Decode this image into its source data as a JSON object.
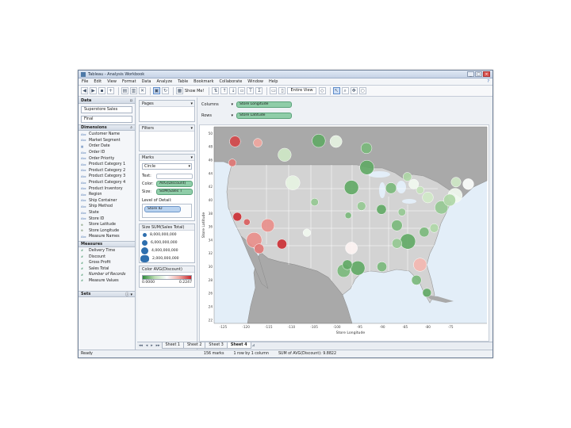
{
  "window": {
    "title": "Tableau - Analysis Workbook",
    "controls": [
      "_",
      "□",
      "×"
    ]
  },
  "menu": [
    "File",
    "Edit",
    "View",
    "Format",
    "Data",
    "Analyze",
    "Table",
    "Bookmark",
    "Collaborate",
    "Window",
    "Help"
  ],
  "toolbar": {
    "show_me_label": "Show Me!",
    "fit_select": "Entire View"
  },
  "data_panel": {
    "header": "Data",
    "datasources": [
      "Superstore Sales",
      "Final"
    ],
    "dimensions_header": "Dimensions",
    "dimensions": [
      {
        "type": "Abc",
        "name": "Customer Name"
      },
      {
        "type": "Abc",
        "name": "Market Segment"
      },
      {
        "type": "date",
        "name": "Order Date"
      },
      {
        "type": "Abc",
        "name": "Order ID"
      },
      {
        "type": "Abc",
        "name": "Order Priority"
      },
      {
        "type": "Abc",
        "name": "Product Category 1"
      },
      {
        "type": "Abc",
        "name": "Product Category 2"
      },
      {
        "type": "Abc",
        "name": "Product Category 3"
      },
      {
        "type": "Abc",
        "name": "Product Category 4"
      },
      {
        "type": "Abc",
        "name": "Product Inventory"
      },
      {
        "type": "Abc",
        "name": "Region"
      },
      {
        "type": "Abc",
        "name": "Ship Container"
      },
      {
        "type": "Abc",
        "name": "Ship Method"
      },
      {
        "type": "Abc",
        "name": "State"
      },
      {
        "type": "Abc",
        "name": "Store ID"
      },
      {
        "type": "geo",
        "name": "Store Latitude"
      },
      {
        "type": "geo",
        "name": "Store Longitude"
      },
      {
        "type": "Abc",
        "name": "Measure Names"
      }
    ],
    "measures_header": "Measures",
    "measures": [
      {
        "name": "Delivery Time",
        "italic": false
      },
      {
        "name": "Discount",
        "italic": false
      },
      {
        "name": "Gross Profit",
        "italic": false
      },
      {
        "name": "Sales Total",
        "italic": false
      },
      {
        "name": "Number of Records",
        "italic": true
      },
      {
        "name": "Measure Values",
        "italic": false
      }
    ],
    "sets_header": "Sets"
  },
  "cards": {
    "pages": "Pages",
    "filters": "Filters",
    "marks": "Marks",
    "mark_type": "Circle",
    "text_label": "Text:",
    "color_label": "Color:",
    "color_pill": "AVG(Discount)",
    "size_label": "Size:",
    "size_pill": "SUM(Sales T",
    "lod_label": "Level of Detail:",
    "lod_pill": "Store ID",
    "size_legend_title": "Size SUM(Sales Total)",
    "size_legend": [
      "8,000,000,000",
      "6,000,000,000",
      "4,000,000,000",
      "2,000,000,000"
    ],
    "color_legend_title": "Color AVG(Discount)",
    "color_min": "0.0000",
    "color_max": "0.2247"
  },
  "shelves": {
    "columns_label": "Columns",
    "columns_pill": "Store Longitude",
    "rows_label": "Rows",
    "rows_pill": "Store Latitude"
  },
  "sheets": {
    "tabs": [
      "Sheet 1",
      "Sheet 2",
      "Sheet 3",
      "Sheet 4"
    ],
    "active": "Sheet 4"
  },
  "status": {
    "ready": "Ready",
    "marks": "156 marks",
    "dims": "1 row by 1 column",
    "sum": "SUM of AVG(Discount): 9.8822"
  },
  "chart_data": {
    "type": "scatter",
    "xlabel": "Store Longitude",
    "ylabel": "Store Latitude",
    "xlim": [
      -127,
      -67
    ],
    "ylim": [
      21.5,
      51
    ],
    "x_ticks": [
      -125,
      -120,
      -115,
      -110,
      -105,
      -100,
      -95,
      -90,
      -85,
      -80,
      -75
    ],
    "y_ticks": [
      22,
      24,
      26,
      28,
      30,
      32,
      34,
      36,
      38,
      40,
      42,
      44,
      46,
      48,
      50
    ],
    "size_measure": "SUM(Sales Total)",
    "color_measure": "AVG(Discount)",
    "color_range": [
      0.0,
      0.2247
    ],
    "points": [
      {
        "lon": -122.4,
        "lat": 48.8,
        "size": 0.35,
        "discount": 0.21
      },
      {
        "lon": -117.4,
        "lat": 48.6,
        "size": 0.25,
        "discount": 0.17
      },
      {
        "lon": -123.0,
        "lat": 45.6,
        "size": 0.2,
        "discount": 0.19
      },
      {
        "lon": -111.5,
        "lat": 46.8,
        "size": 0.45,
        "discount": 0.07
      },
      {
        "lon": -104.0,
        "lat": 48.9,
        "size": 0.45,
        "discount": 0.02
      },
      {
        "lon": -100.2,
        "lat": 48.8,
        "size": 0.4,
        "discount": 0.09
      },
      {
        "lon": -93.5,
        "lat": 47.8,
        "size": 0.35,
        "discount": 0.03
      },
      {
        "lon": -93.4,
        "lat": 44.9,
        "size": 0.5,
        "discount": 0.02
      },
      {
        "lon": -109.7,
        "lat": 42.6,
        "size": 0.5,
        "discount": 0.09
      },
      {
        "lon": -96.8,
        "lat": 41.9,
        "size": 0.5,
        "discount": 0.02
      },
      {
        "lon": -88.1,
        "lat": 41.8,
        "size": 0.35,
        "discount": 0.03
      },
      {
        "lon": -84.5,
        "lat": 43.5,
        "size": 0.25,
        "discount": 0.05
      },
      {
        "lon": -83.1,
        "lat": 42.4,
        "size": 0.3,
        "discount": 0.1
      },
      {
        "lon": -121.9,
        "lat": 37.5,
        "size": 0.25,
        "discount": 0.22
      },
      {
        "lon": -119.8,
        "lat": 36.7,
        "size": 0.15,
        "discount": 0.2
      },
      {
        "lon": -118.2,
        "lat": 34.0,
        "size": 0.55,
        "discount": 0.18
      },
      {
        "lon": -117.1,
        "lat": 32.7,
        "size": 0.3,
        "discount": 0.19
      },
      {
        "lon": -115.2,
        "lat": 36.2,
        "size": 0.45,
        "discount": 0.18
      },
      {
        "lon": -112.1,
        "lat": 33.4,
        "size": 0.3,
        "discount": 0.22
      },
      {
        "lon": -104.9,
        "lat": 39.7,
        "size": 0.2,
        "discount": 0.04
      },
      {
        "lon": -97.5,
        "lat": 37.7,
        "size": 0.15,
        "discount": 0.03
      },
      {
        "lon": -96.8,
        "lat": 32.8,
        "size": 0.4,
        "discount": 0.12
      },
      {
        "lon": -95.4,
        "lat": 29.8,
        "size": 0.5,
        "discount": 0.02
      },
      {
        "lon": -98.5,
        "lat": 29.4,
        "size": 0.45,
        "discount": 0.03
      },
      {
        "lon": -97.7,
        "lat": 30.3,
        "size": 0.3,
        "discount": 0.02
      },
      {
        "lon": -94.6,
        "lat": 39.1,
        "size": 0.25,
        "discount": 0.04
      },
      {
        "lon": -90.2,
        "lat": 38.6,
        "size": 0.3,
        "discount": 0.02
      },
      {
        "lon": -86.8,
        "lat": 36.2,
        "size": 0.35,
        "discount": 0.03
      },
      {
        "lon": -84.4,
        "lat": 33.8,
        "size": 0.55,
        "discount": 0.02
      },
      {
        "lon": -86.8,
        "lat": 33.5,
        "size": 0.3,
        "discount": 0.04
      },
      {
        "lon": -90.1,
        "lat": 30.0,
        "size": 0.3,
        "discount": 0.03
      },
      {
        "lon": -81.7,
        "lat": 41.5,
        "size": 0.2,
        "discount": 0.06
      },
      {
        "lon": -80.0,
        "lat": 40.4,
        "size": 0.35,
        "discount": 0.07
      },
      {
        "lon": -77.0,
        "lat": 38.9,
        "size": 0.45,
        "discount": 0.04
      },
      {
        "lon": -75.2,
        "lat": 40.0,
        "size": 0.4,
        "discount": 0.05
      },
      {
        "lon": -74.0,
        "lat": 40.7,
        "size": 0.5,
        "discount": 0.1
      },
      {
        "lon": -71.1,
        "lat": 42.4,
        "size": 0.35,
        "discount": 0.11
      },
      {
        "lon": -73.8,
        "lat": 42.7,
        "size": 0.3,
        "discount": 0.07
      },
      {
        "lon": -80.8,
        "lat": 35.2,
        "size": 0.3,
        "discount": 0.03
      },
      {
        "lon": -78.6,
        "lat": 35.8,
        "size": 0.25,
        "discount": 0.05
      },
      {
        "lon": -81.7,
        "lat": 30.3,
        "size": 0.45,
        "discount": 0.16
      },
      {
        "lon": -82.5,
        "lat": 28.0,
        "size": 0.3,
        "discount": 0.03
      },
      {
        "lon": -80.2,
        "lat": 26.1,
        "size": 0.25,
        "discount": 0.02
      },
      {
        "lon": -106.6,
        "lat": 35.1,
        "size": 0.2,
        "discount": 0.1
      },
      {
        "lon": -85.7,
        "lat": 38.2,
        "size": 0.2,
        "discount": 0.04
      }
    ]
  }
}
